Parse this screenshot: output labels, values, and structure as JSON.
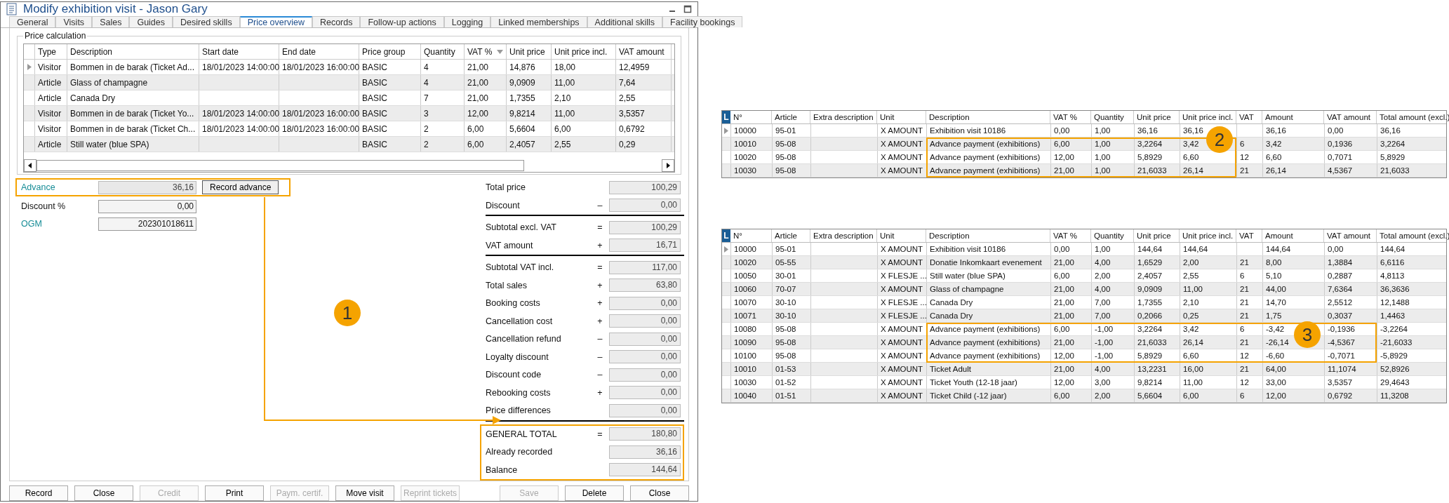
{
  "window": {
    "title": "Modify exhibition visit - Jason Gary"
  },
  "tabs": [
    {
      "label": "General",
      "selected": false
    },
    {
      "label": "Visits",
      "selected": false
    },
    {
      "label": "Sales",
      "selected": false
    },
    {
      "label": "Guides",
      "selected": false
    },
    {
      "label": "Desired skills",
      "selected": false
    },
    {
      "label": "Price overview",
      "selected": true
    },
    {
      "label": "Records",
      "selected": false
    },
    {
      "label": "Follow-up actions",
      "selected": false
    },
    {
      "label": "Logging",
      "selected": false
    },
    {
      "label": "Linked memberships",
      "selected": false
    },
    {
      "label": "Additional skills",
      "selected": false
    },
    {
      "label": "Facility bookings",
      "selected": false
    }
  ],
  "price_calculation": {
    "title": "Price calculation",
    "columns": [
      {
        "label": "Type",
        "sorted": false
      },
      {
        "label": "Description",
        "sorted": false
      },
      {
        "label": "Start date",
        "sorted": false
      },
      {
        "label": "End date",
        "sorted": false
      },
      {
        "label": "Price group",
        "sorted": false
      },
      {
        "label": "Quantity",
        "sorted": false
      },
      {
        "label": "VAT %",
        "sorted": true
      },
      {
        "label": "Unit price",
        "sorted": false
      },
      {
        "label": "Unit price incl.",
        "sorted": false
      },
      {
        "label": "VAT amount",
        "sorted": false
      }
    ],
    "rows": [
      {
        "current": true,
        "cells": [
          "Visitor",
          "Bommen in de barak (Ticket Ad...",
          "18/01/2023 14:00:00",
          "18/01/2023 16:00:00",
          "BASIC",
          "4",
          "21,00",
          "14,876",
          "18,00",
          "12,4959"
        ]
      },
      {
        "current": false,
        "cells": [
          "Article",
          "Glass of champagne",
          "",
          "",
          "BASIC",
          "4",
          "21,00",
          "9,0909",
          "11,00",
          "7,64"
        ]
      },
      {
        "current": false,
        "cells": [
          "Article",
          "Canada Dry",
          "",
          "",
          "BASIC",
          "7",
          "21,00",
          "1,7355",
          "2,10",
          "2,55"
        ]
      },
      {
        "current": false,
        "cells": [
          "Visitor",
          "Bommen in de barak (Ticket Yo...",
          "18/01/2023 14:00:00",
          "18/01/2023 16:00:00",
          "BASIC",
          "3",
          "12,00",
          "9,8214",
          "11,00",
          "3,5357"
        ]
      },
      {
        "current": false,
        "cells": [
          "Visitor",
          "Bommen in de barak (Ticket Ch...",
          "18/01/2023 14:00:00",
          "18/01/2023 16:00:00",
          "BASIC",
          "2",
          "6,00",
          "5,6604",
          "6,00",
          "0,6792"
        ]
      },
      {
        "current": false,
        "cells": [
          "Article",
          "Still water (blue SPA)",
          "",
          "",
          "BASIC",
          "2",
          "6,00",
          "2,4057",
          "2,55",
          "0,29"
        ]
      }
    ]
  },
  "left_fields": [
    {
      "label": "Advance",
      "value": "36,16",
      "linked": true,
      "disabled": true,
      "highlighted": true,
      "button": "Record advance"
    },
    {
      "label": "Discount %",
      "value": "0,00",
      "linked": false,
      "disabled": false,
      "highlighted": false
    },
    {
      "label": "OGM",
      "value": "202301018611",
      "linked": true,
      "disabled": false,
      "highlighted": false
    }
  ],
  "callout": "1",
  "totals": [
    {
      "label": "Total price",
      "value": "100,29",
      "separator": false,
      "highlighted": false
    },
    {
      "label": "Discount",
      "sign": "–",
      "value": "0,00",
      "separator": true,
      "highlighted": false
    },
    {
      "label": "Subtotal excl. VAT",
      "sign": "=",
      "value": "100,29",
      "separator": false,
      "highlighted": false
    },
    {
      "label": "VAT amount",
      "sign": "+",
      "value": "16,71",
      "separator": true,
      "highlighted": false
    },
    {
      "label": "Subtotal VAT incl.",
      "sign": "=",
      "value": "117,00",
      "separator": false,
      "highlighted": false
    },
    {
      "label": "Total sales",
      "sign": "+",
      "value": "63,80",
      "separator": false,
      "highlighted": false
    },
    {
      "label": "Booking costs",
      "sign": "+",
      "value": "0,00",
      "separator": false,
      "highlighted": false
    },
    {
      "label": "Cancellation cost",
      "sign": "+",
      "value": "0,00",
      "separator": false,
      "highlighted": false
    },
    {
      "label": "Cancellation refund",
      "sign": "–",
      "value": "0,00",
      "separator": false,
      "highlighted": false
    },
    {
      "label": "Loyalty discount",
      "sign": "–",
      "value": "0,00",
      "separator": false,
      "highlighted": false
    },
    {
      "label": "Discount code",
      "sign": "–",
      "value": "0,00",
      "separator": false,
      "highlighted": false
    },
    {
      "label": "Rebooking costs",
      "sign": "+",
      "value": "0,00",
      "separator": false,
      "highlighted": false
    },
    {
      "label": "Price differences",
      "value": "0,00",
      "separator": true,
      "highlighted": false
    },
    {
      "label": "GENERAL TOTAL",
      "sign": "=",
      "value": "180,80",
      "separator": false,
      "highlighted": true
    },
    {
      "label": "Already recorded",
      "value": "36,16",
      "separator": false,
      "highlighted": true
    },
    {
      "label": "Balance",
      "value": "144,64",
      "separator": false,
      "highlighted": true
    }
  ],
  "buttons_left": [
    {
      "label": "Record",
      "disabled": false
    },
    {
      "label": "Close",
      "disabled": false
    },
    {
      "label": "Credit",
      "disabled": true
    },
    {
      "label": "Print",
      "disabled": false
    },
    {
      "label": "Paym. certif.",
      "disabled": true
    },
    {
      "label": "Move visit",
      "disabled": false
    },
    {
      "label": "Reprint tickets",
      "disabled": true
    }
  ],
  "buttons_right": [
    {
      "label": "Save",
      "disabled": true
    },
    {
      "label": "Delete",
      "disabled": false
    },
    {
      "label": "Close",
      "disabled": false
    }
  ],
  "article_tables": [
    {
      "corner_label": "L",
      "callout": "2",
      "columns": [
        "N°",
        "Article",
        "Extra description",
        "Unit",
        "Description",
        "VAT %",
        "Quantity",
        "Unit price",
        "Unit price incl.",
        "VAT",
        "Amount",
        "VAT amount",
        "Total amount (excl.)"
      ],
      "rows": [
        {
          "current": true,
          "highlighted": false,
          "cells": [
            "10000",
            "95-01",
            "",
            "X AMOUNT",
            "Exhibition visit 10186",
            "0,00",
            "1,00",
            "36,16",
            "36,16",
            "",
            "36,16",
            "0,00",
            "36,16"
          ]
        },
        {
          "current": false,
          "highlighted": true,
          "cells": [
            "10010",
            "95-08",
            "",
            "X AMOUNT",
            "Advance payment (exhibitions)",
            "6,00",
            "1,00",
            "3,2264",
            "3,42",
            "6",
            "3,42",
            "0,1936",
            "3,2264"
          ]
        },
        {
          "current": false,
          "highlighted": true,
          "cells": [
            "10020",
            "95-08",
            "",
            "X AMOUNT",
            "Advance payment (exhibitions)",
            "12,00",
            "1,00",
            "5,8929",
            "6,60",
            "12",
            "6,60",
            "0,7071",
            "5,8929"
          ]
        },
        {
          "current": false,
          "highlighted": true,
          "cells": [
            "10030",
            "95-08",
            "",
            "X AMOUNT",
            "Advance payment (exhibitions)",
            "21,00",
            "1,00",
            "21,6033",
            "26,14",
            "21",
            "26,14",
            "4,5367",
            "21,6033"
          ]
        }
      ]
    },
    {
      "corner_label": "L",
      "callout": "3",
      "columns": [
        "N°",
        "Article",
        "Extra description",
        "Unit",
        "Description",
        "VAT %",
        "Quantity",
        "Unit price",
        "Unit price incl.",
        "VAT",
        "Amount",
        "VAT amount",
        "Total amount (excl.)"
      ],
      "rows": [
        {
          "current": true,
          "highlighted": false,
          "cells": [
            "10000",
            "95-01",
            "",
            "X AMOUNT",
            "Exhibition visit 10186",
            "0,00",
            "1,00",
            "144,64",
            "144,64",
            "",
            "144,64",
            "0,00",
            "144,64"
          ]
        },
        {
          "current": false,
          "highlighted": false,
          "cells": [
            "10020",
            "05-55",
            "",
            "X AMOUNT",
            "Donatie Inkomkaart evenement",
            "21,00",
            "4,00",
            "1,6529",
            "2,00",
            "21",
            "8,00",
            "1,3884",
            "6,6116"
          ]
        },
        {
          "current": false,
          "highlighted": false,
          "cells": [
            "10050",
            "30-01",
            "",
            "X FLESJE ...",
            "Still water (blue SPA)",
            "6,00",
            "2,00",
            "2,4057",
            "2,55",
            "6",
            "5,10",
            "0,2887",
            "4,8113"
          ]
        },
        {
          "current": false,
          "highlighted": false,
          "cells": [
            "10060",
            "70-07",
            "",
            "X AMOUNT",
            "Glass of champagne",
            "21,00",
            "4,00",
            "9,0909",
            "11,00",
            "21",
            "44,00",
            "7,6364",
            "36,3636"
          ]
        },
        {
          "current": false,
          "highlighted": false,
          "cells": [
            "10070",
            "30-10",
            "",
            "X FLESJE ...",
            "Canada Dry",
            "21,00",
            "7,00",
            "1,7355",
            "2,10",
            "21",
            "14,70",
            "2,5512",
            "12,1488"
          ]
        },
        {
          "current": false,
          "highlighted": false,
          "cells": [
            "10071",
            "30-10",
            "",
            "X FLESJE ...",
            "Canada Dry",
            "21,00",
            "7,00",
            "0,2066",
            "0,25",
            "21",
            "1,75",
            "0,3037",
            "1,4463"
          ]
        },
        {
          "current": false,
          "highlighted": true,
          "cells": [
            "10080",
            "95-08",
            "",
            "X AMOUNT",
            "Advance payment (exhibitions)",
            "6,00",
            "-1,00",
            "3,2264",
            "3,42",
            "6",
            "-3,42",
            "-0,1936",
            "-3,2264"
          ]
        },
        {
          "current": false,
          "highlighted": true,
          "cells": [
            "10090",
            "95-08",
            "",
            "X AMOUNT",
            "Advance payment (exhibitions)",
            "21,00",
            "-1,00",
            "21,6033",
            "26,14",
            "21",
            "-26,14",
            "-4,5367",
            "-21,6033"
          ]
        },
        {
          "current": false,
          "highlighted": true,
          "cells": [
            "10100",
            "95-08",
            "",
            "X AMOUNT",
            "Advance payment (exhibitions)",
            "12,00",
            "-1,00",
            "5,8929",
            "6,60",
            "12",
            "-6,60",
            "-0,7071",
            "-5,8929"
          ]
        },
        {
          "current": false,
          "highlighted": false,
          "cells": [
            "10010",
            "01-53",
            "",
            "X AMOUNT",
            "Ticket Adult",
            "21,00",
            "4,00",
            "13,2231",
            "16,00",
            "21",
            "64,00",
            "11,1074",
            "52,8926"
          ]
        },
        {
          "current": false,
          "highlighted": false,
          "cells": [
            "10030",
            "01-52",
            "",
            "X AMOUNT",
            "Ticket Youth (12-18 jaar)",
            "12,00",
            "3,00",
            "9,8214",
            "11,00",
            "12",
            "33,00",
            "3,5357",
            "29,4643"
          ]
        },
        {
          "current": false,
          "highlighted": false,
          "cells": [
            "10040",
            "01-51",
            "",
            "X AMOUNT",
            "Ticket Child (-12 jaar)",
            "6,00",
            "2,00",
            "5,6604",
            "6,00",
            "6",
            "12,00",
            "0,6792",
            "11,3208"
          ]
        }
      ]
    }
  ]
}
